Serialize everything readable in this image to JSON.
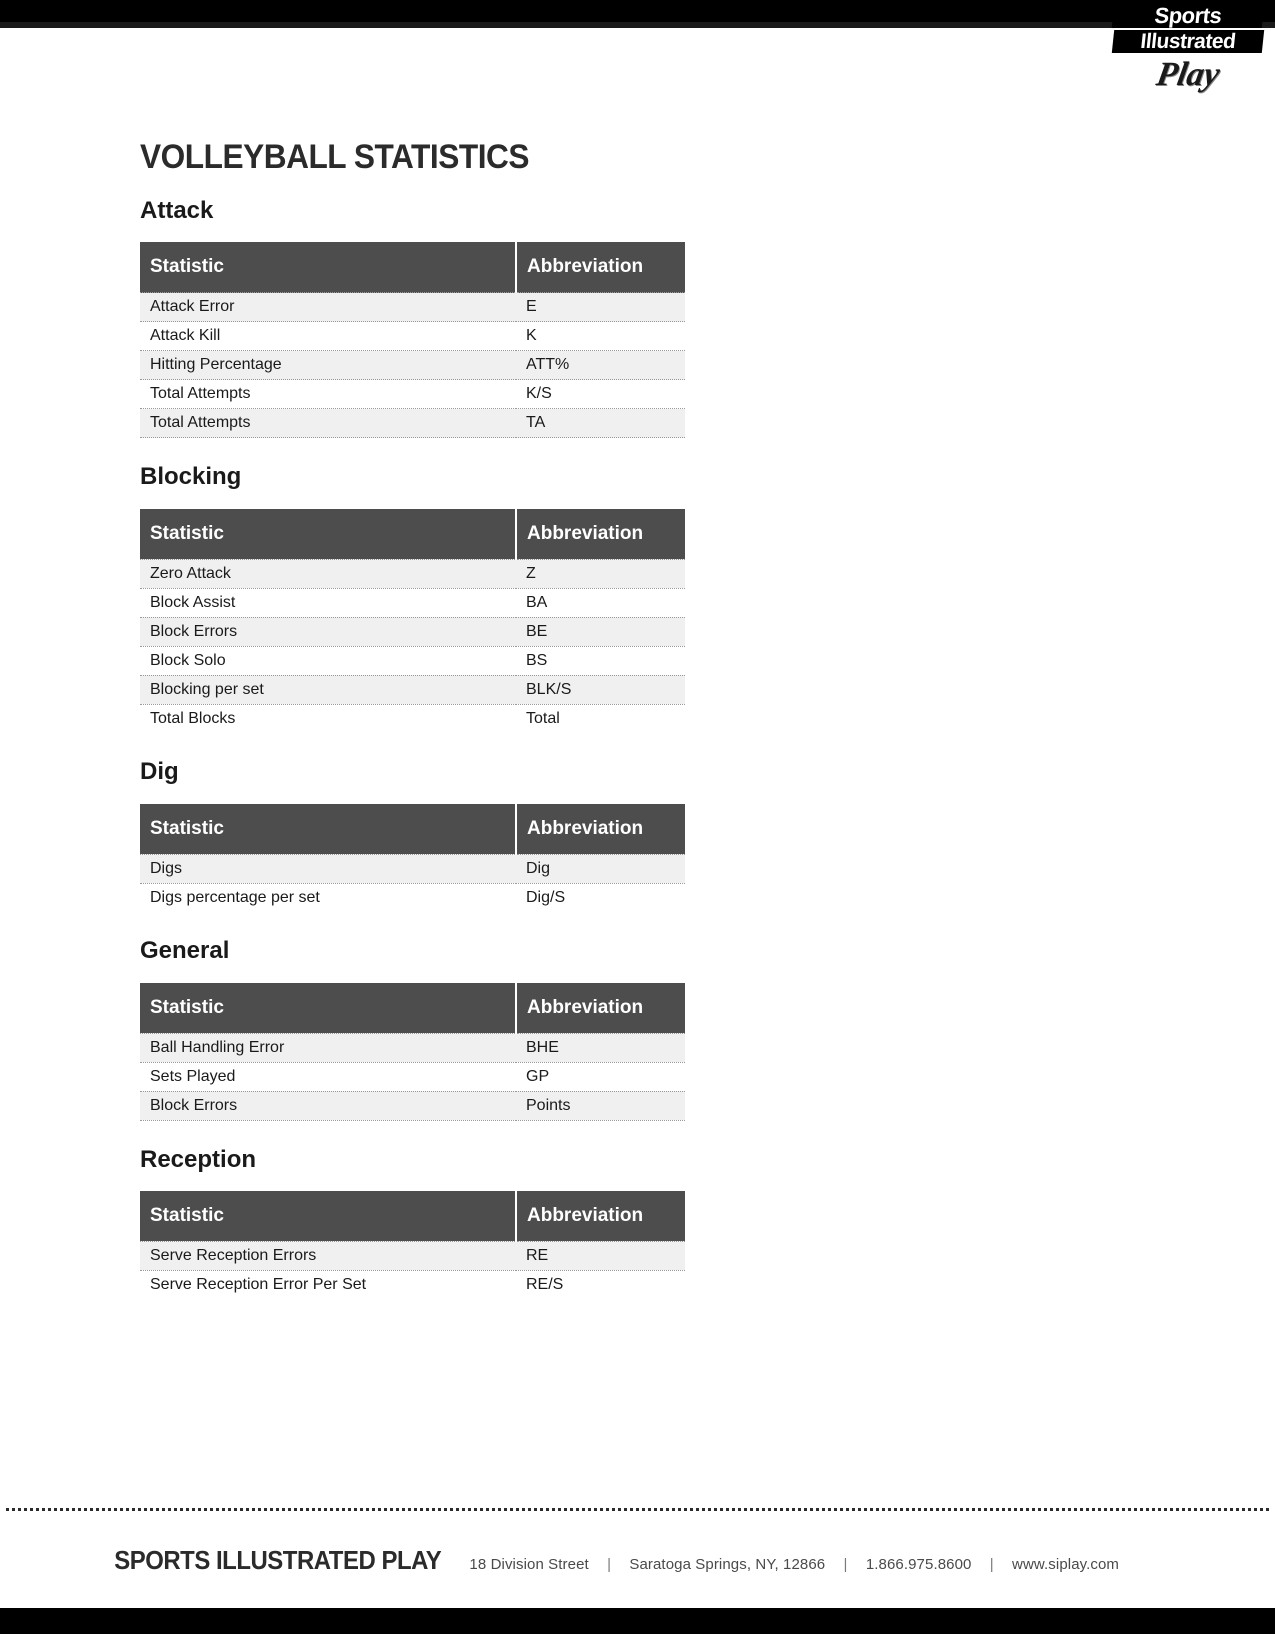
{
  "document": {
    "title": "VOLLEYBALL STATISTICS"
  },
  "logo": {
    "line1": "Sports",
    "line2": "Illustrated",
    "line3": "Play"
  },
  "table_headers": {
    "statistic": "Statistic",
    "abbreviation": "Abbreviation"
  },
  "sections": [
    {
      "heading": "Attack",
      "rows": [
        {
          "statistic": "Attack Error",
          "abbreviation": "E"
        },
        {
          "statistic": "Attack Kill",
          "abbreviation": "K"
        },
        {
          "statistic": "Hitting Percentage",
          "abbreviation": "ATT%"
        },
        {
          "statistic": "Total Attempts",
          "abbreviation": "K/S"
        },
        {
          "statistic": "Total Attempts",
          "abbreviation": "TA"
        }
      ]
    },
    {
      "heading": "Blocking",
      "rows": [
        {
          "statistic": "Zero Attack",
          "abbreviation": "Z"
        },
        {
          "statistic": "Block Assist",
          "abbreviation": "BA"
        },
        {
          "statistic": "Block Errors",
          "abbreviation": "BE"
        },
        {
          "statistic": "Block Solo",
          "abbreviation": "BS"
        },
        {
          "statistic": "Blocking per set",
          "abbreviation": "BLK/S"
        },
        {
          "statistic": "Total Blocks",
          "abbreviation": "Total"
        }
      ]
    },
    {
      "heading": "Dig",
      "rows": [
        {
          "statistic": "Digs",
          "abbreviation": "Dig"
        },
        {
          "statistic": "Digs percentage per set",
          "abbreviation": "Dig/S"
        }
      ]
    },
    {
      "heading": "General",
      "rows": [
        {
          "statistic": "Ball Handling Error",
          "abbreviation": "BHE"
        },
        {
          "statistic": "Sets Played",
          "abbreviation": "GP"
        },
        {
          "statistic": "Block Errors",
          "abbreviation": "Points"
        }
      ]
    },
    {
      "heading": "Reception",
      "rows": [
        {
          "statistic": "Serve Reception Errors",
          "abbreviation": "RE"
        },
        {
          "statistic": "Serve Reception Error Per Set",
          "abbreviation": "RE/S"
        }
      ]
    }
  ],
  "footer": {
    "brand": "SPORTS ILLUSTRATED PLAY",
    "address": "18 Division Street",
    "city_state_zip": "Saratoga Springs, NY, 12866",
    "phone": "1.866.975.8600",
    "website": "www.siplay.com",
    "separator": "|"
  }
}
